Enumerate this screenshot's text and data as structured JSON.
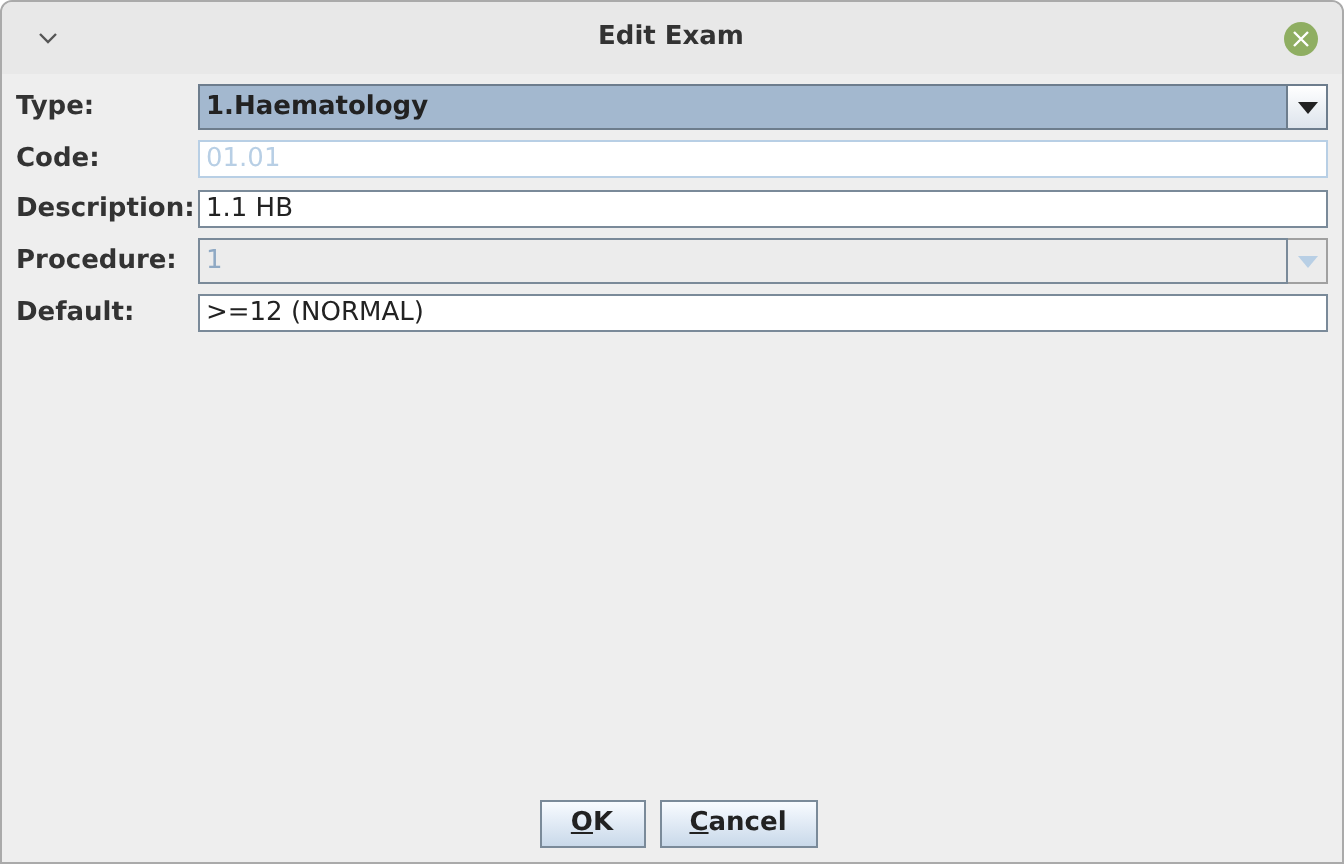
{
  "window": {
    "title": "Edit Exam"
  },
  "fields": [
    {
      "label": "Type:",
      "kind": "combo",
      "value": "1.Haematology",
      "disabled": false
    },
    {
      "label": "Code:",
      "kind": "text",
      "value": "01.01",
      "disabled": true
    },
    {
      "label": "Description:",
      "kind": "text",
      "value": "1.1 HB",
      "disabled": false
    },
    {
      "label": "Procedure:",
      "kind": "combo",
      "value": "1",
      "disabled": true
    },
    {
      "label": "Default:",
      "kind": "text",
      "value": ">=12 (NORMAL)",
      "disabled": false
    }
  ],
  "buttons": [
    "OK",
    "Cancel"
  ]
}
